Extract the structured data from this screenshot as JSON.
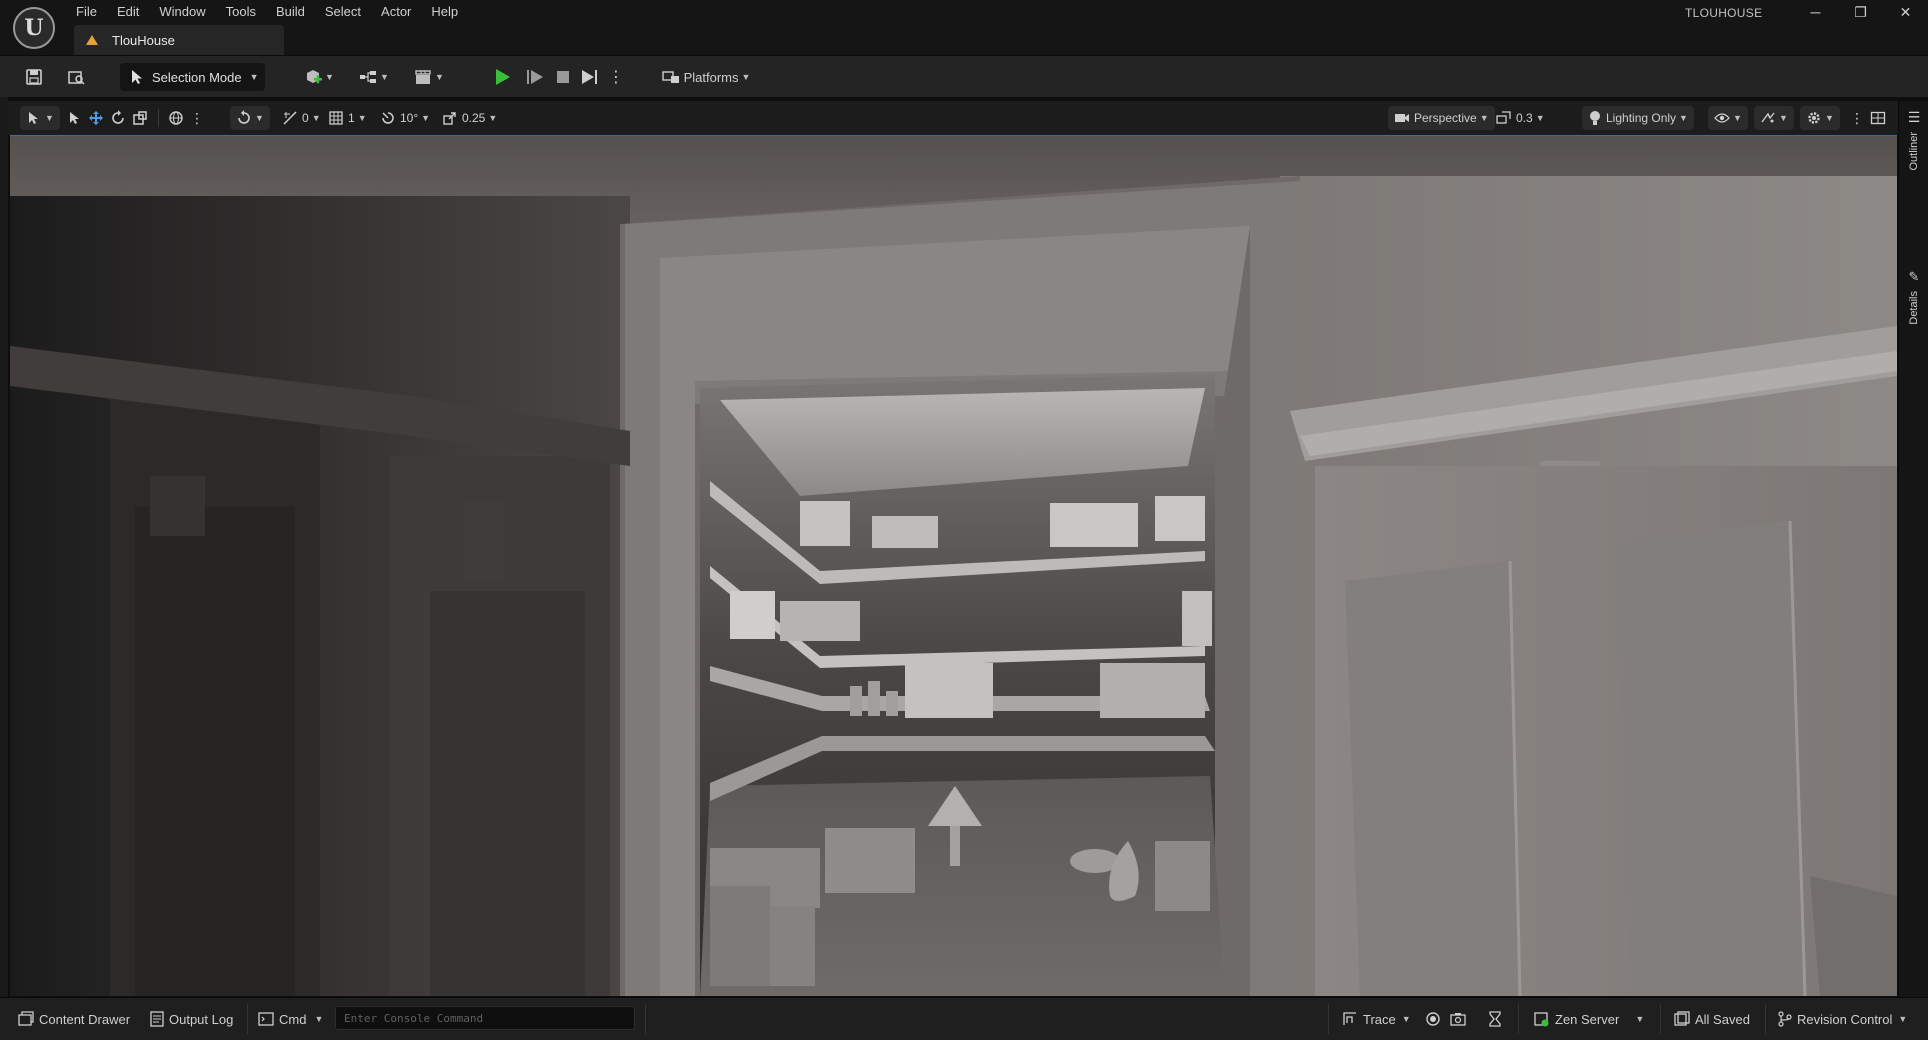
{
  "app": {
    "project_name": "TLOUHOUSE",
    "level_name": "TlouHouse",
    "logo_glyph": "U"
  },
  "menu": {
    "items": [
      "File",
      "Edit",
      "Window",
      "Tools",
      "Build",
      "Select",
      "Actor",
      "Help"
    ]
  },
  "window_controls": {
    "minimize": "─",
    "restore": "❐",
    "close": "✕"
  },
  "toolbar": {
    "mode_label": "Selection Mode",
    "platforms_label": "Platforms"
  },
  "viewport_toolbar": {
    "grid_snap_value": "0",
    "surface_snap_value": "1",
    "rotation_snap_value": "10°",
    "scale_snap_value": "0.25",
    "view_mode_label": "Perspective",
    "camera_speed_value": "0.3",
    "lighting_mode_label": "Lighting Only"
  },
  "right_dock": {
    "outliner_label": "Outliner",
    "details_label": "Details"
  },
  "statusbar": {
    "content_drawer_label": "Content Drawer",
    "output_log_label": "Output Log",
    "cmd_label": "Cmd",
    "console_placeholder": "Enter Console Command",
    "trace_label": "Trace",
    "zen_server_label": "Zen Server",
    "all_saved_label": "All Saved",
    "revision_control_label": "Revision Control"
  },
  "colors": {
    "accent_play": "#3bbf3b",
    "level_icon": "#e5a23a",
    "viewport_highlight": "#3a6aa8",
    "zen_server_status": "#3bbf3b"
  }
}
